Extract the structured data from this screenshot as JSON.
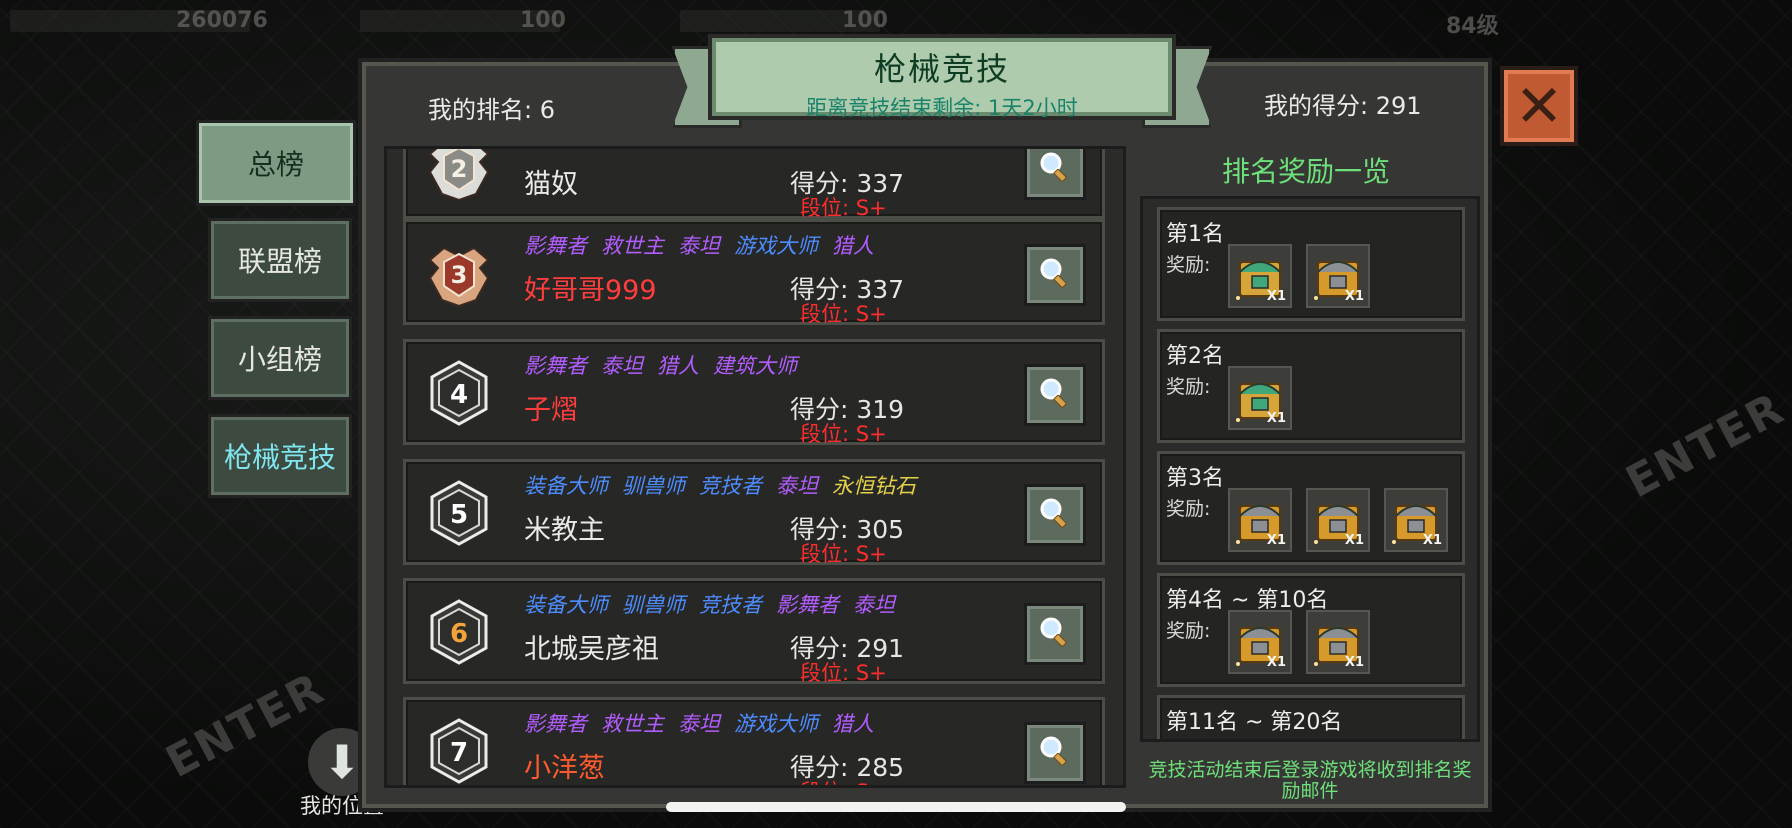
{
  "background": {
    "hud_values": [
      "260076",
      "100",
      "100",
      "84级"
    ],
    "signs": [
      "ENTER",
      "ENTER"
    ]
  },
  "tabs": [
    {
      "label": "总榜",
      "active": true
    },
    {
      "label": "联盟榜",
      "active": false
    },
    {
      "label": "小组榜",
      "active": false
    },
    {
      "label": "枪械竞技",
      "active": false
    }
  ],
  "my_position": {
    "icon": "down-arrow-icon",
    "label": "我的位置"
  },
  "header": {
    "title": "枪械竞技",
    "countdown": "距离竞技结束剩余: 1天2小时",
    "my_rank": "我的排名: 6",
    "my_score": "我的得分: 291",
    "close_icon": "close-x-icon"
  },
  "colors": {
    "accent_green": "#6ee07a",
    "tier_red": "#ff2d2d",
    "title_purple": "#b35cff",
    "title_blue": "#4d8cff",
    "title_yellow": "#e6d24a",
    "name_red": "#ff3d3d",
    "name_white": "#e9e9e6"
  },
  "ranking": [
    {
      "rank": "2",
      "titles": [],
      "name": "猫奴",
      "name_color": "#e9e9e6",
      "score": "得分: 337",
      "tier": "段位: S+",
      "badge": "silver"
    },
    {
      "rank": "3",
      "titles": [
        {
          "text": "影舞者",
          "color": "#b35cff"
        },
        {
          "text": "救世主",
          "color": "#b35cff"
        },
        {
          "text": "泰坦",
          "color": "#b35cff"
        },
        {
          "text": "游戏大师",
          "color": "#4d8cff"
        },
        {
          "text": "猎人",
          "color": "#b35cff"
        }
      ],
      "name": "好哥哥999",
      "name_color": "#ff3d3d",
      "score": "得分: 337",
      "tier": "段位: S+",
      "badge": "bronze"
    },
    {
      "rank": "4",
      "titles": [
        {
          "text": "影舞者",
          "color": "#b35cff"
        },
        {
          "text": "泰坦",
          "color": "#b35cff"
        },
        {
          "text": "猎人",
          "color": "#b35cff"
        },
        {
          "text": "建筑大师",
          "color": "#b35cff"
        }
      ],
      "name": "子熠",
      "name_color": "#ff3d3d",
      "score": "得分: 319",
      "tier": "段位: S+",
      "badge": "hex"
    },
    {
      "rank": "5",
      "titles": [
        {
          "text": "装备大师",
          "color": "#4d8cff"
        },
        {
          "text": "驯兽师",
          "color": "#4d8cff"
        },
        {
          "text": "竞技者",
          "color": "#4d8cff"
        },
        {
          "text": "泰坦",
          "color": "#b35cff"
        },
        {
          "text": "永恒钻石",
          "color": "#e6d24a"
        }
      ],
      "name": "米教主",
      "name_color": "#e9e9e6",
      "score": "得分: 305",
      "tier": "段位: S+",
      "badge": "hex"
    },
    {
      "rank": "6",
      "titles": [
        {
          "text": "装备大师",
          "color": "#4d8cff"
        },
        {
          "text": "驯兽师",
          "color": "#4d8cff"
        },
        {
          "text": "竞技者",
          "color": "#4d8cff"
        },
        {
          "text": "影舞者",
          "color": "#b35cff"
        },
        {
          "text": "泰坦",
          "color": "#b35cff"
        }
      ],
      "name": "北城吴彦祖",
      "name_color": "#e9e9e6",
      "score": "得分: 291",
      "tier": "段位: S+",
      "badge": "hex-orange"
    },
    {
      "rank": "7",
      "titles": [
        {
          "text": "影舞者",
          "color": "#b35cff"
        },
        {
          "text": "救世主",
          "color": "#b35cff"
        },
        {
          "text": "泰坦",
          "color": "#b35cff"
        },
        {
          "text": "游戏大师",
          "color": "#4d8cff"
        },
        {
          "text": "猎人",
          "color": "#b35cff"
        }
      ],
      "name": "小洋葱",
      "name_color": "#ff5a2d",
      "score": "得分: 285",
      "tier": "段位: S+",
      "badge": "hex"
    }
  ],
  "rewards": {
    "title": "排名奖励一览",
    "reward_label": "奖励:",
    "tiers": [
      {
        "name": "第1名",
        "items": [
          {
            "icon": "green-chest-icon",
            "qty": "X1"
          },
          {
            "icon": "gold-chest-icon",
            "qty": "X1"
          }
        ]
      },
      {
        "name": "第2名",
        "items": [
          {
            "icon": "green-chest-icon",
            "qty": "X1"
          }
        ]
      },
      {
        "name": "第3名",
        "items": [
          {
            "icon": "gold-chest-icon",
            "qty": "X1"
          },
          {
            "icon": "gold-chest-icon",
            "qty": "X1"
          },
          {
            "icon": "gold-chest-icon",
            "qty": "X1"
          }
        ]
      },
      {
        "name": "第4名 ~ 第10名",
        "items": [
          {
            "icon": "gold-chest-icon",
            "qty": "X1"
          },
          {
            "icon": "gold-chest-icon",
            "qty": "X1"
          }
        ]
      },
      {
        "name": "第11名 ~ 第20名",
        "items": []
      }
    ],
    "note": "竞技活动结束后登录游戏将收到排名奖励邮件"
  }
}
